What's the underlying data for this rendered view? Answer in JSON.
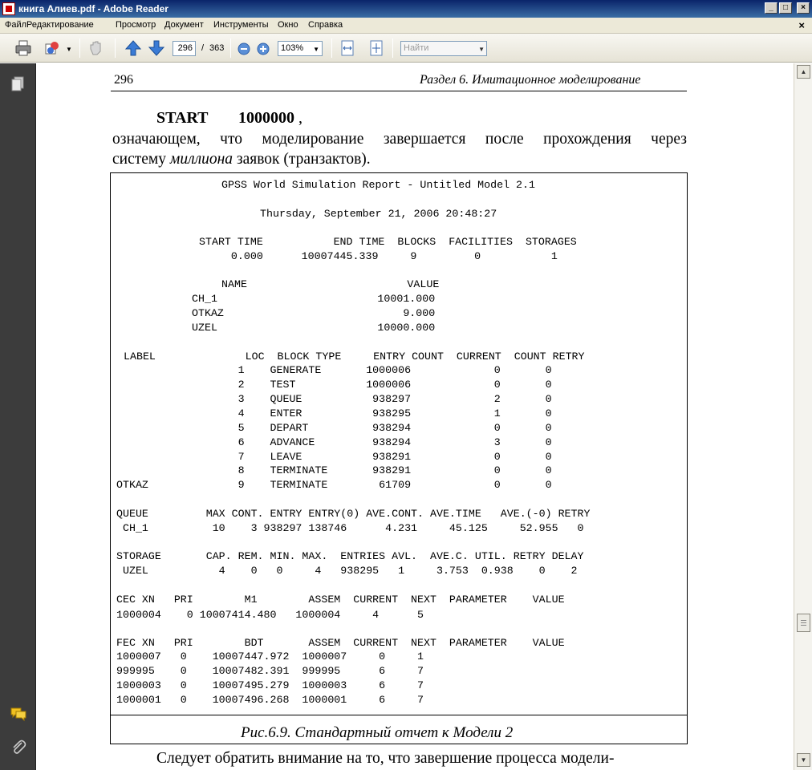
{
  "window": {
    "title": "книга Алиев.pdf - Adobe Reader",
    "minimize": "_",
    "maximize": "□",
    "close": "×"
  },
  "menu": {
    "items": [
      "Файл",
      "Редактирование",
      "Просмотр",
      "Документ",
      "Инструменты",
      "Окно",
      "Справка"
    ],
    "doc_close": "×"
  },
  "toolbar": {
    "page_number": "296",
    "page_separator": "/",
    "page_count": "363",
    "zoom": "103%",
    "search_placeholder": "Найти"
  },
  "page": {
    "header_number": "296",
    "header_title": "Раздел 6. Имитационное моделирование",
    "start_cmd": "START",
    "start_value": "1000000",
    "start_comma": ",",
    "para1_line1": "означающем, что моделирование завершается после прохождения через",
    "para1_line2_a": "систему ",
    "para1_line2_em": "миллиона",
    "para1_line2_b": " заявок (транзактов).",
    "caption": "Рис.6.9. Стандартный отчет к Модели 2",
    "footer_text": "Следует обратить внимание на то, что завершение процесса модели-"
  },
  "report": {
    "title": "GPSS World Simulation Report - Untitled Model 2.1",
    "date": "Thursday, September 21, 2006 20:48:27",
    "summary_header": "START TIME           END TIME  BLOCKS  FACILITIES  STORAGES",
    "summary_values": "     0.000      10007445.339     9         0           1",
    "names_header": "NAME                         VALUE",
    "names": [
      "CH_1                         10001.000",
      "OTKAZ                            9.000",
      "UZEL                         10000.000"
    ],
    "blocks_header": "LABEL              LOC  BLOCK TYPE     ENTRY COUNT  CURRENT  COUNT RETRY",
    "blocks": [
      "                   1    GENERATE       1000006             0       0",
      "                   2    TEST           1000006             0       0",
      "                   3    QUEUE           938297             2       0",
      "                   4    ENTER           938295             1       0",
      "                   5    DEPART          938294             0       0",
      "                   6    ADVANCE         938294             3       0",
      "                   7    LEAVE           938291             0       0",
      "                   8    TERMINATE       938291             0       0",
      "OTKAZ              9    TERMINATE        61709             0       0"
    ],
    "queue_header": "QUEUE         MAX CONT. ENTRY ENTRY(0) AVE.CONT. AVE.TIME   AVE.(-0) RETRY",
    "queue_row": " CH_1          10    3 938297 138746      4.231     45.125     52.955   0",
    "storage_header": "STORAGE       CAP. REM. MIN. MAX.  ENTRIES AVL.  AVE.C. UTIL. RETRY DELAY",
    "storage_row": " UZEL           4    0   0     4   938295   1     3.753  0.938    0    2",
    "cec_header": "CEC XN   PRI        M1        ASSEM  CURRENT  NEXT  PARAMETER    VALUE",
    "cec_row": "1000004    0 10007414.480   1000004     4      5",
    "fec_header": "FEC XN   PRI        BDT       ASSEM  CURRENT  NEXT  PARAMETER    VALUE",
    "fec_rows": [
      "1000007   0    10007447.972  1000007     0     1",
      "999995    0    10007482.391  999995      6     7",
      "1000003   0    10007495.279  1000003     6     7",
      "1000001   0    10007496.268  1000001     6     7"
    ]
  },
  "colors": {
    "titlebar": "#0a246a",
    "navpanel": "#3c3c3c",
    "menubar": "#ece9d8"
  },
  "icons": [
    "print-icon",
    "share-icon",
    "hand-icon",
    "prev-page-icon",
    "next-page-icon",
    "zoom-out-icon",
    "zoom-in-icon",
    "fit-width-icon",
    "fit-page-icon",
    "pages-icon",
    "comments-icon",
    "attachment-icon"
  ]
}
